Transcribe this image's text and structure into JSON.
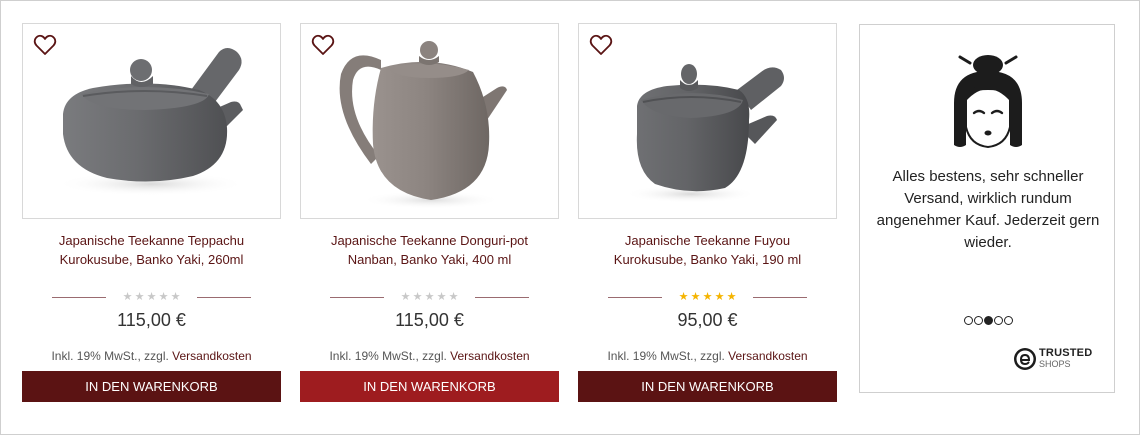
{
  "products": [
    {
      "title": "Japanische Teekanne Teppachu Kurokusube, Banko Yaki, 260ml",
      "price": "115,00 €",
      "rating": 0,
      "tax_prefix": "Inkl. 19% MwSt., zzgl. ",
      "tax_link": "Versandkosten",
      "cart_label": "IN DEN WARENKORB",
      "button_color": "#5b1313"
    },
    {
      "title": "Japanische Teekanne Donguri-pot Nanban, Banko Yaki, 400 ml",
      "price": "115,00 €",
      "rating": 0,
      "tax_prefix": "Inkl. 19% MwSt., zzgl. ",
      "tax_link": "Versandkosten",
      "cart_label": "IN DEN WARENKORB",
      "button_color": "#9e1c1f"
    },
    {
      "title": "Japanische Teekanne Fuyou Kurokusube, Banko Yaki, 190 ml",
      "price": "95,00 €",
      "rating": 5,
      "tax_prefix": "Inkl. 19% MwSt., zzgl. ",
      "tax_link": "Versandkosten",
      "cart_label": "IN DEN WARENKORB",
      "button_color": "#5b1313"
    }
  ],
  "review": {
    "text": "Alles bestens, sehr schneller Versand, wirklich rundum angenehmer Kauf. Jederzeit gern wieder.",
    "dots_total": 5,
    "dots_active_index": 2,
    "badge_line1": "TRUSTED",
    "badge_line2": "SHOPS"
  },
  "colors": {
    "star_filled": "#f5b400",
    "star_empty": "#c8c8c8",
    "title_text": "#5a1414",
    "heart": "#5a1414"
  },
  "icons": {
    "wishlist": "heart-outline-icon",
    "avatar": "geisha-avatar-icon",
    "badge": "trusted-shops-logo-icon"
  }
}
